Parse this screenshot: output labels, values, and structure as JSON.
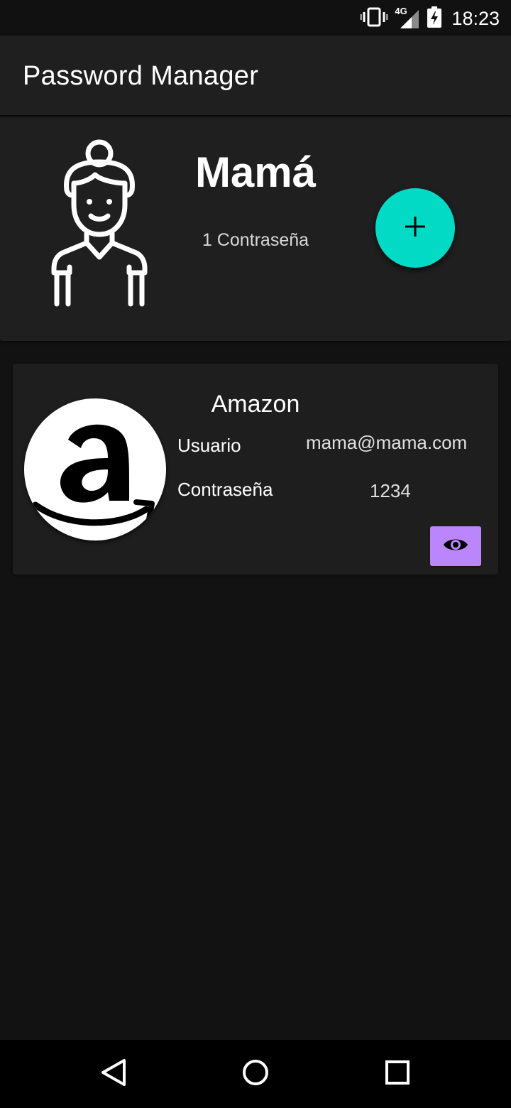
{
  "status_bar": {
    "time": "18:23",
    "network_label": "4G",
    "icons": [
      "vibrate-icon",
      "signal-icon",
      "battery-charging-icon"
    ]
  },
  "app_bar": {
    "title": "Password Manager"
  },
  "profile": {
    "name": "Mamá",
    "count_label": "1 Contraseña",
    "avatar_icon": "woman-avatar-icon",
    "add_icon": "plus-icon"
  },
  "entries": [
    {
      "site": "Amazon",
      "logo_icon": "amazon-logo",
      "user_label": "Usuario",
      "user_value": "mama@mama.com",
      "password_label": "Contraseña",
      "password_value": "1234",
      "reveal_icon": "eye-icon"
    }
  ],
  "nav_bar": {
    "icons": [
      "back-icon",
      "home-icon",
      "recents-icon"
    ]
  },
  "colors": {
    "background": "#121212",
    "surface": "#1f1f1f",
    "fab": "#03dac5",
    "reveal_button": "#bb86fc"
  }
}
